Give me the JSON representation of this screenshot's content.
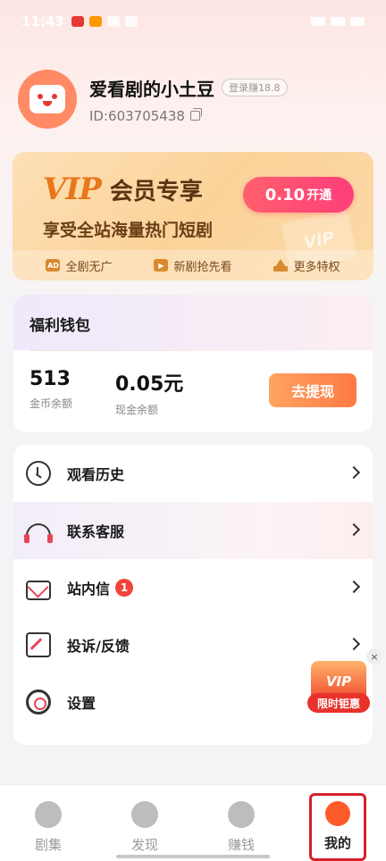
{
  "status_bar": {
    "time": "11:43"
  },
  "profile": {
    "name": "爱看剧的小土豆",
    "login_tag": "登录赚18.8",
    "user_id": "ID:603705438"
  },
  "vip": {
    "logo": "VIP",
    "title": "会员专享",
    "subtitle": "享受全站海量热门短剧",
    "price": "0.10",
    "open_label": "开通",
    "deco_text": "VIP",
    "benefits": [
      {
        "icon": "ad-icon",
        "icon_text": "AD",
        "label": "全剧无广"
      },
      {
        "icon": "play-icon",
        "icon_text": "▶",
        "label": "新剧抢先看"
      },
      {
        "icon": "crown-icon",
        "label": "更多特权"
      }
    ]
  },
  "wallet": {
    "title": "福利钱包",
    "coins_value": "513",
    "coins_label": "金币余额",
    "cash_value": "0.05元",
    "cash_label": "现金余额",
    "withdraw_label": "去提现"
  },
  "menu": {
    "items": [
      {
        "label": "观看历史",
        "icon": "clock-icon"
      },
      {
        "label": "联系客服",
        "icon": "headset-icon"
      },
      {
        "label": "站内信",
        "icon": "mail-icon",
        "badge": "1"
      },
      {
        "label": "投诉/反馈",
        "icon": "edit-icon"
      },
      {
        "label": "设置",
        "icon": "gear-icon"
      }
    ]
  },
  "promo": {
    "badge_text": "VIP",
    "label": "限时钜惠",
    "close": "×"
  },
  "bottom_nav": {
    "items": [
      {
        "label": "剧集",
        "icon": "film-reel-icon"
      },
      {
        "label": "发现",
        "icon": "planet-icon"
      },
      {
        "label": "赚钱",
        "icon": "gift-icon"
      },
      {
        "label": "我的",
        "icon": "tv-face-icon",
        "active": true
      }
    ]
  },
  "colors": {
    "accent": "#ff5a2a",
    "vip_button": "#ff3e7a",
    "withdraw_button": "#ff7a45",
    "badge": "#f0453a",
    "highlight_frame": "#d6202a"
  }
}
